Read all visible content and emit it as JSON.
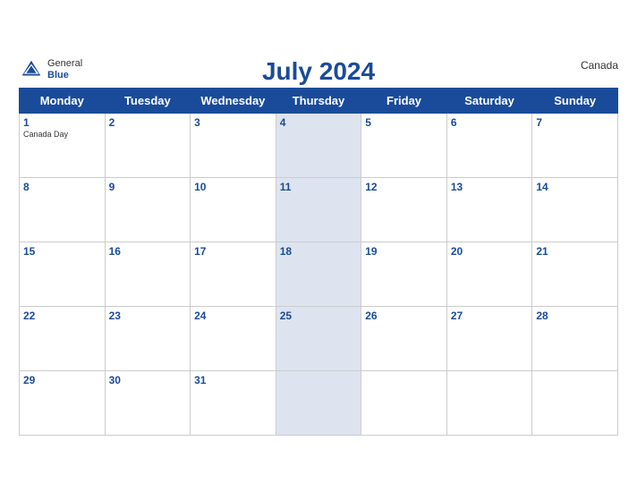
{
  "header": {
    "logo_general": "General",
    "logo_blue": "Blue",
    "title": "July 2024",
    "country": "Canada"
  },
  "days_of_week": [
    "Monday",
    "Tuesday",
    "Wednesday",
    "Thursday",
    "Friday",
    "Saturday",
    "Sunday"
  ],
  "weeks": [
    [
      {
        "day": "1",
        "holiday": "Canada Day",
        "dark": false
      },
      {
        "day": "2",
        "holiday": "",
        "dark": false
      },
      {
        "day": "3",
        "holiday": "",
        "dark": false
      },
      {
        "day": "4",
        "holiday": "",
        "dark": true
      },
      {
        "day": "5",
        "holiday": "",
        "dark": false
      },
      {
        "day": "6",
        "holiday": "",
        "dark": false
      },
      {
        "day": "7",
        "holiday": "",
        "dark": false
      }
    ],
    [
      {
        "day": "8",
        "holiday": "",
        "dark": false
      },
      {
        "day": "9",
        "holiday": "",
        "dark": false
      },
      {
        "day": "10",
        "holiday": "",
        "dark": false
      },
      {
        "day": "11",
        "holiday": "",
        "dark": true
      },
      {
        "day": "12",
        "holiday": "",
        "dark": false
      },
      {
        "day": "13",
        "holiday": "",
        "dark": false
      },
      {
        "day": "14",
        "holiday": "",
        "dark": false
      }
    ],
    [
      {
        "day": "15",
        "holiday": "",
        "dark": false
      },
      {
        "day": "16",
        "holiday": "",
        "dark": false
      },
      {
        "day": "17",
        "holiday": "",
        "dark": false
      },
      {
        "day": "18",
        "holiday": "",
        "dark": true
      },
      {
        "day": "19",
        "holiday": "",
        "dark": false
      },
      {
        "day": "20",
        "holiday": "",
        "dark": false
      },
      {
        "day": "21",
        "holiday": "",
        "dark": false
      }
    ],
    [
      {
        "day": "22",
        "holiday": "",
        "dark": false
      },
      {
        "day": "23",
        "holiday": "",
        "dark": false
      },
      {
        "day": "24",
        "holiday": "",
        "dark": false
      },
      {
        "day": "25",
        "holiday": "",
        "dark": true
      },
      {
        "day": "26",
        "holiday": "",
        "dark": false
      },
      {
        "day": "27",
        "holiday": "",
        "dark": false
      },
      {
        "day": "28",
        "holiday": "",
        "dark": false
      }
    ],
    [
      {
        "day": "29",
        "holiday": "",
        "dark": false
      },
      {
        "day": "30",
        "holiday": "",
        "dark": false
      },
      {
        "day": "31",
        "holiday": "",
        "dark": false
      },
      {
        "day": "",
        "holiday": "",
        "dark": true
      },
      {
        "day": "",
        "holiday": "",
        "dark": false
      },
      {
        "day": "",
        "holiday": "",
        "dark": false
      },
      {
        "day": "",
        "holiday": "",
        "dark": false
      }
    ]
  ]
}
